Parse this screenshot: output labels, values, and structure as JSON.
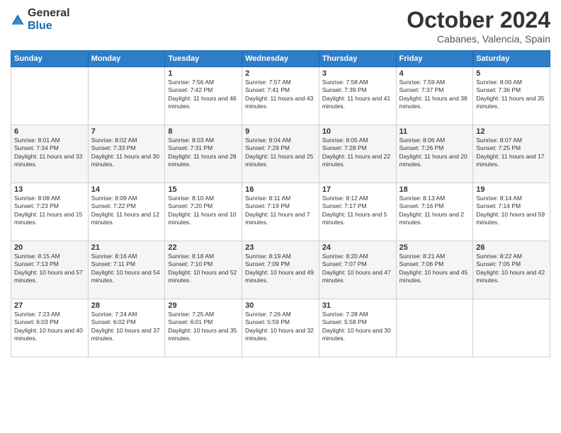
{
  "header": {
    "logo_general": "General",
    "logo_blue": "Blue",
    "month_title": "October 2024",
    "location": "Cabanes, Valencia, Spain"
  },
  "days_of_week": [
    "Sunday",
    "Monday",
    "Tuesday",
    "Wednesday",
    "Thursday",
    "Friday",
    "Saturday"
  ],
  "weeks": [
    [
      {
        "day": "",
        "info": ""
      },
      {
        "day": "",
        "info": ""
      },
      {
        "day": "1",
        "info": "Sunrise: 7:56 AM\nSunset: 7:42 PM\nDaylight: 11 hours and 46 minutes."
      },
      {
        "day": "2",
        "info": "Sunrise: 7:57 AM\nSunset: 7:41 PM\nDaylight: 11 hours and 43 minutes."
      },
      {
        "day": "3",
        "info": "Sunrise: 7:58 AM\nSunset: 7:39 PM\nDaylight: 11 hours and 41 minutes."
      },
      {
        "day": "4",
        "info": "Sunrise: 7:59 AM\nSunset: 7:37 PM\nDaylight: 11 hours and 38 minutes."
      },
      {
        "day": "5",
        "info": "Sunrise: 8:00 AM\nSunset: 7:36 PM\nDaylight: 11 hours and 35 minutes."
      }
    ],
    [
      {
        "day": "6",
        "info": "Sunrise: 8:01 AM\nSunset: 7:34 PM\nDaylight: 11 hours and 33 minutes."
      },
      {
        "day": "7",
        "info": "Sunrise: 8:02 AM\nSunset: 7:33 PM\nDaylight: 11 hours and 30 minutes."
      },
      {
        "day": "8",
        "info": "Sunrise: 8:03 AM\nSunset: 7:31 PM\nDaylight: 11 hours and 28 minutes."
      },
      {
        "day": "9",
        "info": "Sunrise: 8:04 AM\nSunset: 7:29 PM\nDaylight: 11 hours and 25 minutes."
      },
      {
        "day": "10",
        "info": "Sunrise: 8:05 AM\nSunset: 7:28 PM\nDaylight: 11 hours and 22 minutes."
      },
      {
        "day": "11",
        "info": "Sunrise: 8:06 AM\nSunset: 7:26 PM\nDaylight: 11 hours and 20 minutes."
      },
      {
        "day": "12",
        "info": "Sunrise: 8:07 AM\nSunset: 7:25 PM\nDaylight: 11 hours and 17 minutes."
      }
    ],
    [
      {
        "day": "13",
        "info": "Sunrise: 8:08 AM\nSunset: 7:23 PM\nDaylight: 11 hours and 15 minutes."
      },
      {
        "day": "14",
        "info": "Sunrise: 8:09 AM\nSunset: 7:22 PM\nDaylight: 11 hours and 12 minutes."
      },
      {
        "day": "15",
        "info": "Sunrise: 8:10 AM\nSunset: 7:20 PM\nDaylight: 11 hours and 10 minutes."
      },
      {
        "day": "16",
        "info": "Sunrise: 8:11 AM\nSunset: 7:19 PM\nDaylight: 11 hours and 7 minutes."
      },
      {
        "day": "17",
        "info": "Sunrise: 8:12 AM\nSunset: 7:17 PM\nDaylight: 11 hours and 5 minutes."
      },
      {
        "day": "18",
        "info": "Sunrise: 8:13 AM\nSunset: 7:16 PM\nDaylight: 11 hours and 2 minutes."
      },
      {
        "day": "19",
        "info": "Sunrise: 8:14 AM\nSunset: 7:14 PM\nDaylight: 10 hours and 59 minutes."
      }
    ],
    [
      {
        "day": "20",
        "info": "Sunrise: 8:15 AM\nSunset: 7:13 PM\nDaylight: 10 hours and 57 minutes."
      },
      {
        "day": "21",
        "info": "Sunrise: 8:16 AM\nSunset: 7:11 PM\nDaylight: 10 hours and 54 minutes."
      },
      {
        "day": "22",
        "info": "Sunrise: 8:18 AM\nSunset: 7:10 PM\nDaylight: 10 hours and 52 minutes."
      },
      {
        "day": "23",
        "info": "Sunrise: 8:19 AM\nSunset: 7:09 PM\nDaylight: 10 hours and 49 minutes."
      },
      {
        "day": "24",
        "info": "Sunrise: 8:20 AM\nSunset: 7:07 PM\nDaylight: 10 hours and 47 minutes."
      },
      {
        "day": "25",
        "info": "Sunrise: 8:21 AM\nSunset: 7:06 PM\nDaylight: 10 hours and 45 minutes."
      },
      {
        "day": "26",
        "info": "Sunrise: 8:22 AM\nSunset: 7:05 PM\nDaylight: 10 hours and 42 minutes."
      }
    ],
    [
      {
        "day": "27",
        "info": "Sunrise: 7:23 AM\nSunset: 6:03 PM\nDaylight: 10 hours and 40 minutes."
      },
      {
        "day": "28",
        "info": "Sunrise: 7:24 AM\nSunset: 6:02 PM\nDaylight: 10 hours and 37 minutes."
      },
      {
        "day": "29",
        "info": "Sunrise: 7:25 AM\nSunset: 6:01 PM\nDaylight: 10 hours and 35 minutes."
      },
      {
        "day": "30",
        "info": "Sunrise: 7:26 AM\nSunset: 5:59 PM\nDaylight: 10 hours and 32 minutes."
      },
      {
        "day": "31",
        "info": "Sunrise: 7:28 AM\nSunset: 5:58 PM\nDaylight: 10 hours and 30 minutes."
      },
      {
        "day": "",
        "info": ""
      },
      {
        "day": "",
        "info": ""
      }
    ]
  ]
}
